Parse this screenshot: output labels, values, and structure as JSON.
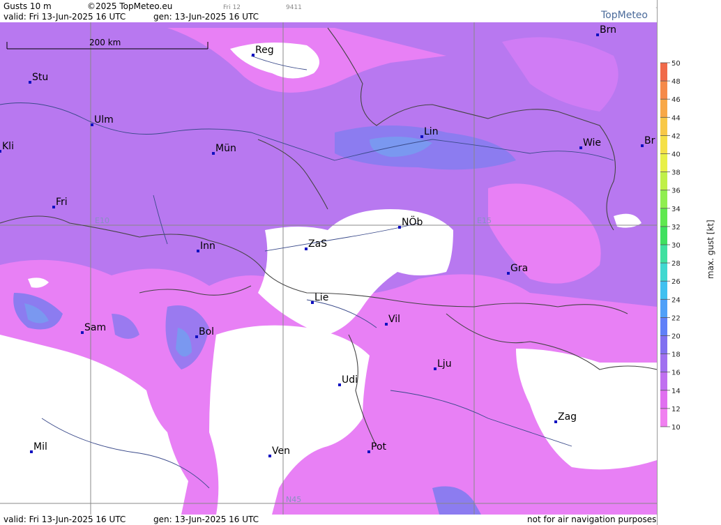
{
  "header": {
    "product": "Gusts 10 m",
    "copyright": "©2025 TopMeteo.eu",
    "run_day": "Fri 12",
    "code": "9411",
    "valid": "valid:  Fri  13-Jun-2025  16 UTC",
    "gen": "gen: 13-Jun-2025 16 UTC",
    "logo": "TopMeteo"
  },
  "scale_bar": {
    "label": "200 km"
  },
  "grid_labels": {
    "e10": "E10",
    "e15": "E15",
    "n45": "N45"
  },
  "cities": [
    {
      "name": "Reg",
      "id": "city-reg"
    },
    {
      "name": "Brn",
      "id": "city-brn"
    },
    {
      "name": "Stu",
      "id": "city-stu"
    },
    {
      "name": "Ulm",
      "id": "city-ulm"
    },
    {
      "name": "Mün",
      "id": "city-mun"
    },
    {
      "name": "Lin",
      "id": "city-lin"
    },
    {
      "name": "Wie",
      "id": "city-wie"
    },
    {
      "name": "Br",
      "id": "city-br"
    },
    {
      "name": "Kli",
      "id": "city-kli"
    },
    {
      "name": "Fri",
      "id": "city-fri"
    },
    {
      "name": "NÖb",
      "id": "city-nob"
    },
    {
      "name": "Inn",
      "id": "city-inn"
    },
    {
      "name": "ZaS",
      "id": "city-zas"
    },
    {
      "name": "Gra",
      "id": "city-gra"
    },
    {
      "name": "Lie",
      "id": "city-lie"
    },
    {
      "name": "Sam",
      "id": "city-sam"
    },
    {
      "name": "Bol",
      "id": "city-bol"
    },
    {
      "name": "Vil",
      "id": "city-vil"
    },
    {
      "name": "Lju",
      "id": "city-lju"
    },
    {
      "name": "Udi",
      "id": "city-udi"
    },
    {
      "name": "Zag",
      "id": "city-zag"
    },
    {
      "name": "Mil",
      "id": "city-mil"
    },
    {
      "name": "Ven",
      "id": "city-ven"
    },
    {
      "name": "Pot",
      "id": "city-pot"
    }
  ],
  "legend": {
    "title": "max. gust [kt]",
    "ticks": [
      "50",
      "48",
      "46",
      "44",
      "42",
      "40",
      "38",
      "36",
      "34",
      "32",
      "30",
      "28",
      "26",
      "24",
      "22",
      "20",
      "18",
      "16",
      "14",
      "12",
      "10"
    ],
    "colors": [
      "#f06a4a",
      "#f58a4a",
      "#f8a848",
      "#f8c848",
      "#f5e048",
      "#e8f048",
      "#c0f048",
      "#90ee50",
      "#60e850",
      "#40e060",
      "#40e0a0",
      "#40d8d0",
      "#40c0f0",
      "#50a0f8",
      "#6080f8",
      "#8070f0",
      "#a070f0",
      "#c070f0",
      "#e070f0",
      "#f080f0"
    ]
  },
  "footer": {
    "valid": "valid:  Fri  13-Jun-2025  16 UTC",
    "gen": "gen: 13-Jun-2025 16 UTC",
    "disclaimer": "not for air navigation purposes"
  },
  "colors": {
    "gust_low": "#f080f0",
    "gust_mid": "#c070f0",
    "gust_high": "#8070f0",
    "gust_peak": "#6f9af0"
  }
}
